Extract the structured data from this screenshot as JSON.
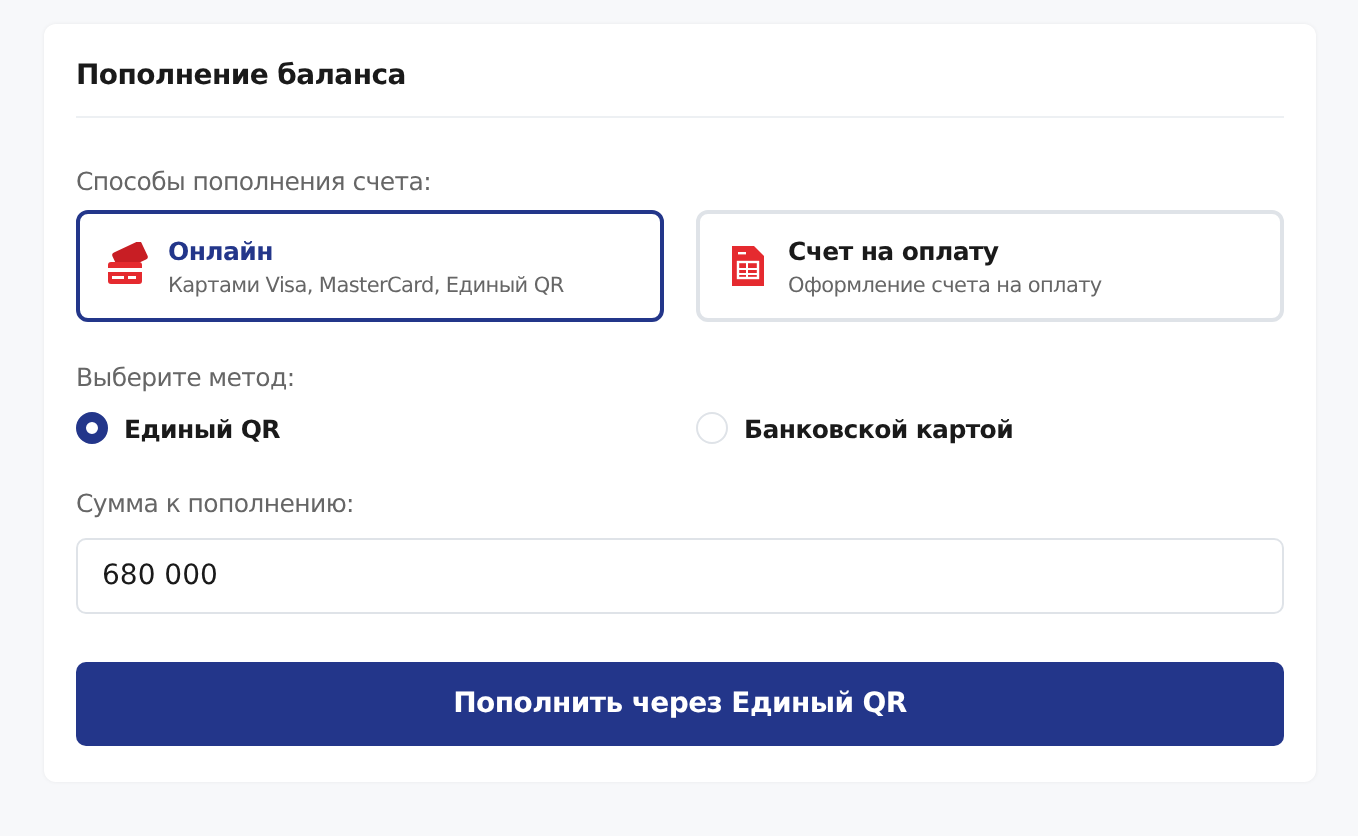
{
  "title": "Пополнение баланса",
  "methods_label": "Способы пополнения счета:",
  "methods": [
    {
      "kind": "card",
      "title": "Онлайн",
      "subtitle": "Картами Visa, MasterCard, Единый QR",
      "selected": true
    },
    {
      "kind": "invoice",
      "title": "Счет на оплату",
      "subtitle": "Оформление счета на оплату",
      "selected": false
    }
  ],
  "choose_label": "Выберите метод:",
  "options": [
    {
      "label": "Единый QR",
      "selected": true
    },
    {
      "label": "Банковской картой",
      "selected": false
    }
  ],
  "amount_label": "Сумма к пополнению:",
  "amount": {
    "value": "680 000"
  },
  "submit": "Пополнить через Единый QR"
}
